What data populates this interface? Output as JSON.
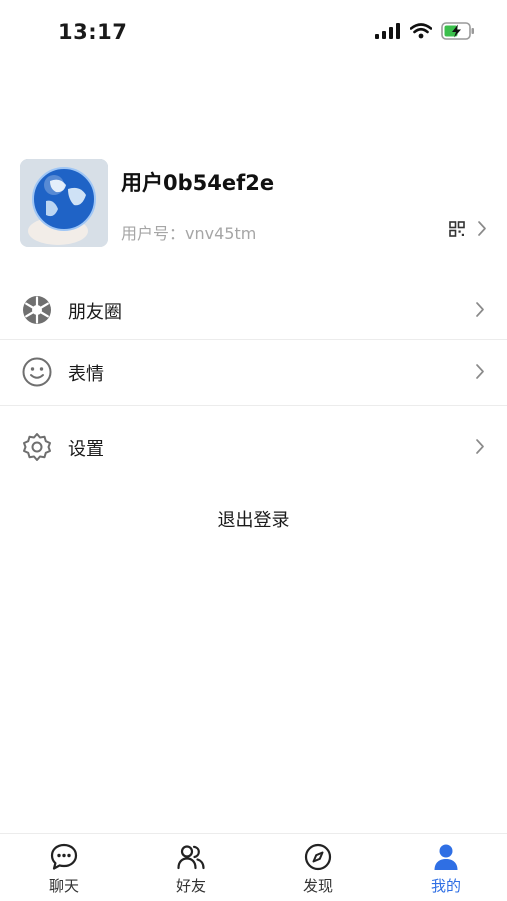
{
  "status_bar": {
    "time": "13:17"
  },
  "profile": {
    "username": "用户0b54ef2e",
    "user_id": "用户号：vnv45tm"
  },
  "menu": [
    {
      "label": "朋友圈",
      "icon": "aperture-icon"
    },
    {
      "label": "表情",
      "icon": "smiley-icon"
    },
    {
      "label": "设置",
      "icon": "gear-icon"
    }
  ],
  "logout_label": "退出登录",
  "tabbar": {
    "tabs": [
      {
        "label": "聊天",
        "icon": "chat-bubble-icon"
      },
      {
        "label": "好友",
        "icon": "friends-icon"
      },
      {
        "label": "发现",
        "icon": "compass-icon"
      },
      {
        "label": "我的",
        "icon": "person-icon",
        "active": true
      }
    ],
    "active_color": "#2f6fe4"
  }
}
